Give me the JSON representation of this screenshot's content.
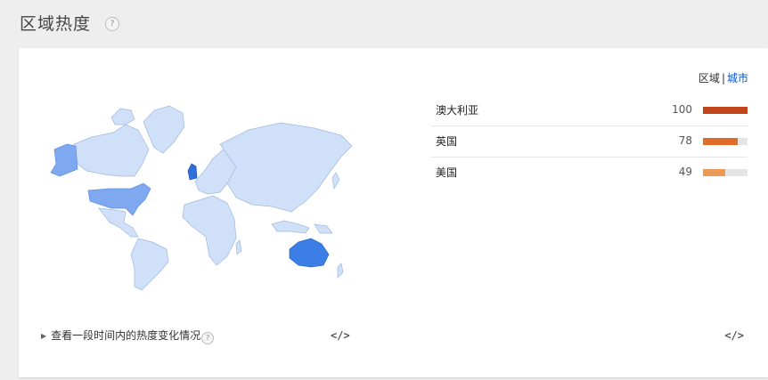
{
  "header": {
    "title": "区域热度",
    "help_icon": "?"
  },
  "toggle": {
    "region_label": "区域",
    "separator": "|",
    "city_label": "城市"
  },
  "ranking": [
    {
      "name": "澳大利亚",
      "value": "100",
      "fraction": 1.0,
      "color": "#c1441a"
    },
    {
      "name": "英国",
      "value": "78",
      "fraction": 0.78,
      "color": "#e06a2a"
    },
    {
      "name": "美国",
      "value": "49",
      "fraction": 0.49,
      "color": "#ec9a55"
    }
  ],
  "footer": {
    "timeline_label": "查看一段时间内的热度变化情况",
    "timeline_help": "?",
    "embed_label": "</>"
  },
  "colors": {
    "land": "#cfe0f8",
    "land_border": "#9fb9dd",
    "australia": "#3b7fe6",
    "uk": "#2f6fd9",
    "usa": "#7ea8f0",
    "toggle_link": "#1155cc"
  }
}
